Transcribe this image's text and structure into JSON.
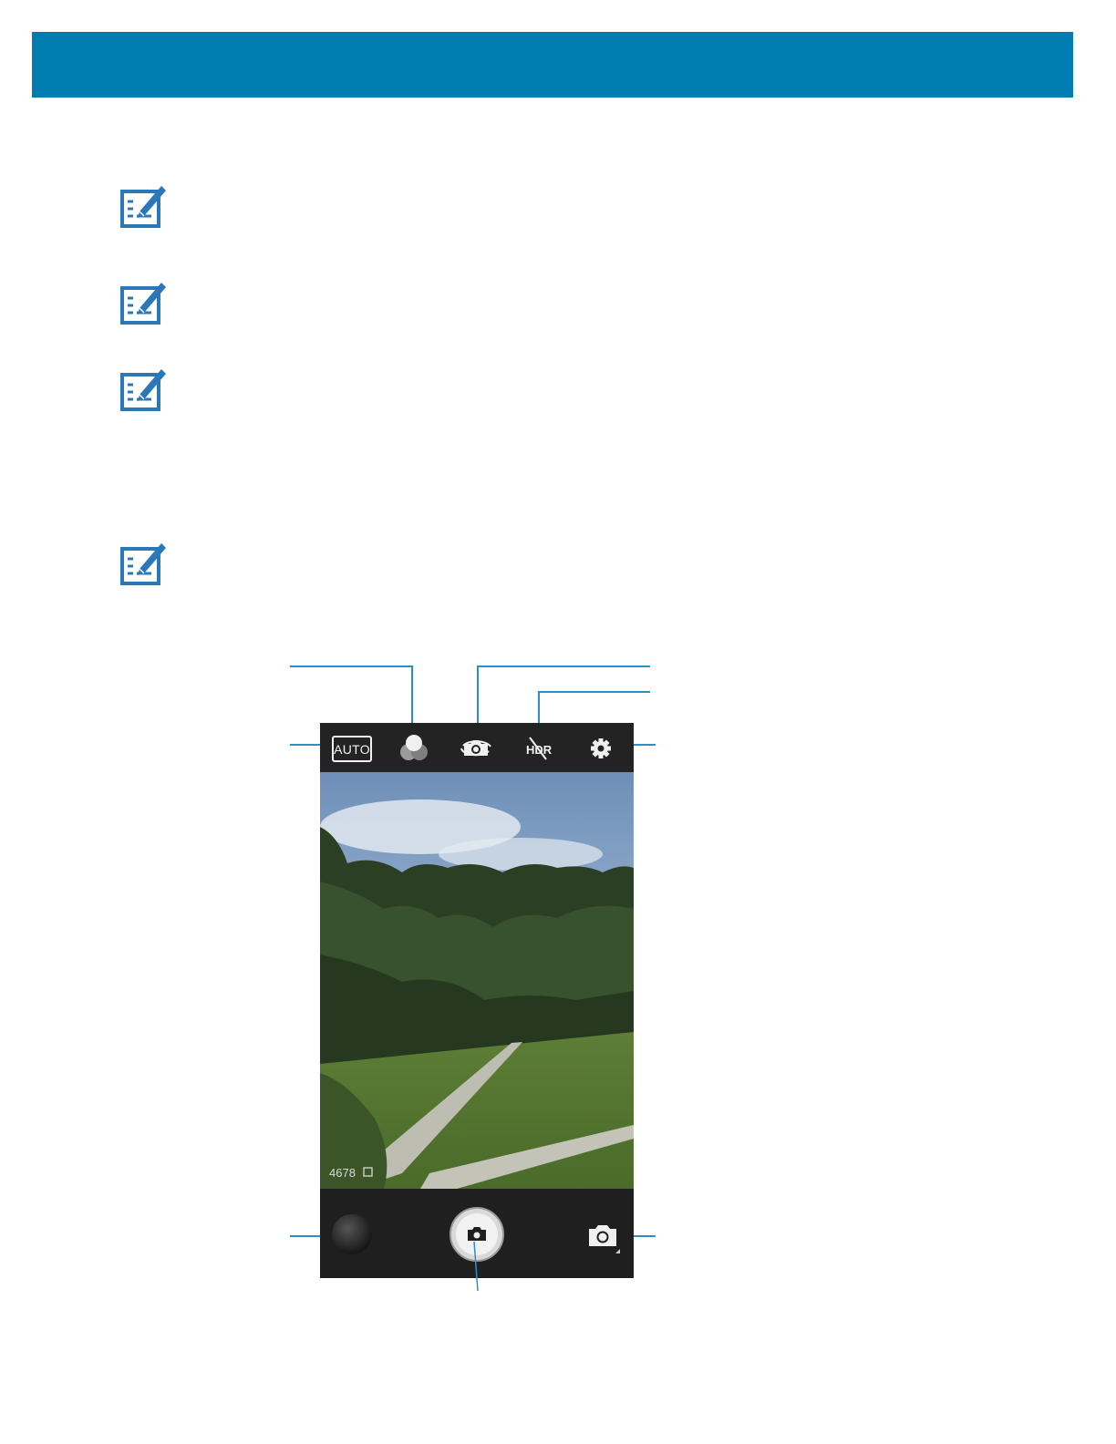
{
  "page": {
    "header_color": "#007cb0",
    "note_icon": "note-pencil-icon"
  },
  "camera": {
    "top_bar": {
      "scene_mode_label": "AUTO",
      "icons": [
        "color-effect-icon",
        "switch-camera-icon",
        "hdr-off-icon",
        "settings-gear-icon"
      ]
    },
    "viewfinder": {
      "remaining_shots": "4678"
    },
    "bottom_bar": {
      "icons": [
        "gallery-thumbnail",
        "shutter-button",
        "camera-mode-icon"
      ]
    }
  }
}
